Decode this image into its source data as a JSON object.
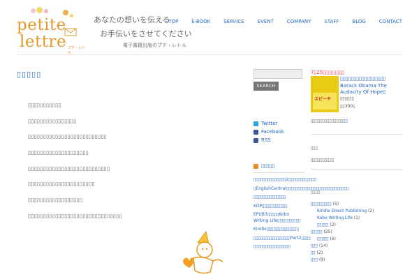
{
  "header": {
    "logo_line1": "petite",
    "logo_line2": "lettre",
    "logo_sub": "プチ・レトル",
    "tagline1": "あなたの想いを伝える",
    "tagline2": "お手伝いをさせてください",
    "tagline3": "電子書籍出版のプチ・レトル"
  },
  "nav": [
    "TOP",
    "E-BOOK",
    "SERVICE",
    "EVENT",
    "COMPANY",
    "STAFF",
    "BLOG",
    "CONTACT"
  ],
  "main": {
    "title": "▯▯▯▯▯",
    "lines": [
      "▯▯▯▯▯▯▯▯▯▯▯",
      "▯▯▯▯▯▯▯▯▯▯▯▯▯▯▯▯",
      "▯▯▯▯▯▯▯▯▯▯▯▯▯▯▯▯▯▯▯▯▯▯▯▯▯▯",
      "▯▯▯▯▯▯▯▯▯▯▯▯▯▯▯▯▯▯▯▯",
      "▯▯▯▯▯▯▯▯▯▯▯▯▯▯▯▯▯▯▯▯▯▯▯▯▯▯▯",
      "▯▯▯▯▯▯▯▯▯▯▯▯▯▯▯▯▯▯▯▯▯▯",
      "▯▯▯▯▯▯▯▯▯▯▯▯▯▯▯▯▯▯",
      "▯▯▯▯▯▯▯▯▯▯▯▯▯▯▯▯▯▯▯▯▯▯▯▯▯▯▯▯▯▯▯"
    ]
  },
  "sidebar1": {
    "search_button": "SEARCH",
    "social": [
      {
        "label": "Twitter",
        "icon": "twitter-icon",
        "color": "#2ea6dd"
      },
      {
        "label": "Facebook",
        "icon": "facebook-icon",
        "color": "#3b5998"
      },
      {
        "label": "RSS",
        "icon": "rss-icon",
        "color": "#3b5998"
      }
    ],
    "rss_heading": "▯▯▯▯▯",
    "rss_items": [
      "▯▯▯▯▯▯▯▯▯▯▯▯▯▯2▯▯▯▯▯▯▯▯▯▯▯▯",
      "▯EnglishCentral▯▯▯▯▯▯▯▯▯▯▯▯▯▯▯▯▯▯▯▯▯▯▯▯▯▯▯",
      "▯▯▯▯▯▯▯▯▯▯▯▯▯▯",
      "KDP▯▯▯▯▯▯▯▯▯▯▯",
      "EPUB3▯▯▯▯▯Kobo Writing Life▯▯▯▯▯▯▯▯▯▯",
      "Kindle▯▯▯▯▯▯▯▯▯▯▯▯▯▯",
      "▯▯▯▯▯▯▯▯▯▯▯▯▯▯▯▯Part2▯▯▯▯",
      "▯▯▯▯▯▯▯▯▯▯▯▯▯▯▯▯"
    ]
  },
  "sidebar2": {
    "promo_heading": "7▯25▯▯▯▯▯▯▯▯",
    "promo_title": "▯▯▯▯▯▯▯▯▯▯▯▯▯▯▯▯▯ Barack Obama The Audacity Of Hope▯",
    "promo_author": "▯▯▯▯▯▯",
    "promo_price": "▯▯300▯",
    "book_text": "スピーチ",
    "promo_note": "▯▯▯▯▯▯▯▯▯▯▯▯▯▯",
    "promo_note_link": "▯▯",
    "tags_heading": "▯▯▯",
    "tags_text": "▯▯▯▯▯▯▯▯▯▯",
    "cat_heading": "▯▯▯▯",
    "categories": [
      {
        "label": "▯▯▯▯▯▯▯▯▯",
        "count": "(5)",
        "indent": 0
      },
      {
        "label": "Kindle Direct Publishing",
        "count": "(2)",
        "indent": 1
      },
      {
        "label": "Kobo Writing Life",
        "count": "(1)",
        "indent": 1
      },
      {
        "label": "▯▯▯▯▯",
        "count": "(2)",
        "indent": 1
      },
      {
        "label": "▯▯▯▯▯",
        "count": "(25)",
        "indent": 0
      },
      {
        "label": "▯▯▯▯▯",
        "count": "(6)",
        "indent": 1
      },
      {
        "label": "▯▯▯",
        "count": "(14)",
        "indent": 0
      },
      {
        "label": "▯▯",
        "count": "(2)",
        "indent": 0
      },
      {
        "label": "▯▯▯",
        "count": "(9)",
        "indent": 0
      }
    ]
  }
}
